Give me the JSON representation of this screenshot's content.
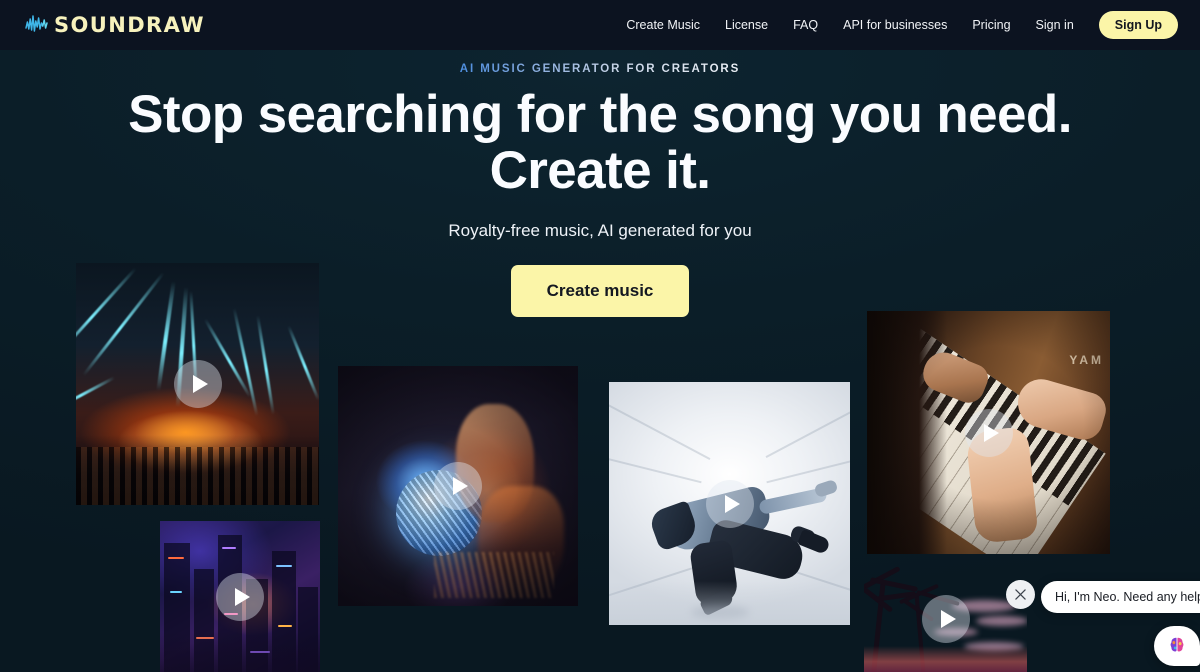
{
  "header": {
    "logo_text": "SOUNDRAW",
    "logo_icon": "waveform-icon",
    "nav": [
      {
        "label": "Create Music"
      },
      {
        "label": "License"
      },
      {
        "label": "FAQ"
      },
      {
        "label": "API for businesses"
      },
      {
        "label": "Pricing"
      },
      {
        "label": "Sign in"
      }
    ],
    "signup_label": "Sign Up",
    "colors": {
      "bar_bg": "#0c1320",
      "logo": "#f7f2bd",
      "accent": "#fbf5a8"
    }
  },
  "hero": {
    "eyebrow": "AI MUSIC GENERATOR FOR CREATORS",
    "headline_line1": "Stop searching for the song you need.",
    "headline_line2": "Create it.",
    "subtitle": "Royalty-free music, AI generated for you",
    "cta_label": "Create music"
  },
  "tiles": [
    {
      "id": "tile-concert",
      "name": "concert-lasers-video",
      "play_icon": "play-icon"
    },
    {
      "id": "tile-city",
      "name": "night-city-video",
      "play_icon": "play-icon"
    },
    {
      "id": "tile-disco",
      "name": "disco-ball-video",
      "play_icon": "play-icon"
    },
    {
      "id": "tile-dancer",
      "name": "breakdancer-video",
      "play_icon": "play-icon"
    },
    {
      "id": "tile-piano",
      "name": "piano-hands-video",
      "play_icon": "play-icon"
    },
    {
      "id": "tile-tropical",
      "name": "tropical-sunset-video",
      "play_icon": "play-icon"
    }
  ],
  "chat": {
    "message": "Hi, I'm Neo. Need any help?",
    "close_icon": "close-icon",
    "launcher_icon": "brain-icon"
  },
  "theme": {
    "page_bg": "#0b1c24",
    "text": "#fafcff",
    "accent_yellow": "#fbf5a8"
  }
}
